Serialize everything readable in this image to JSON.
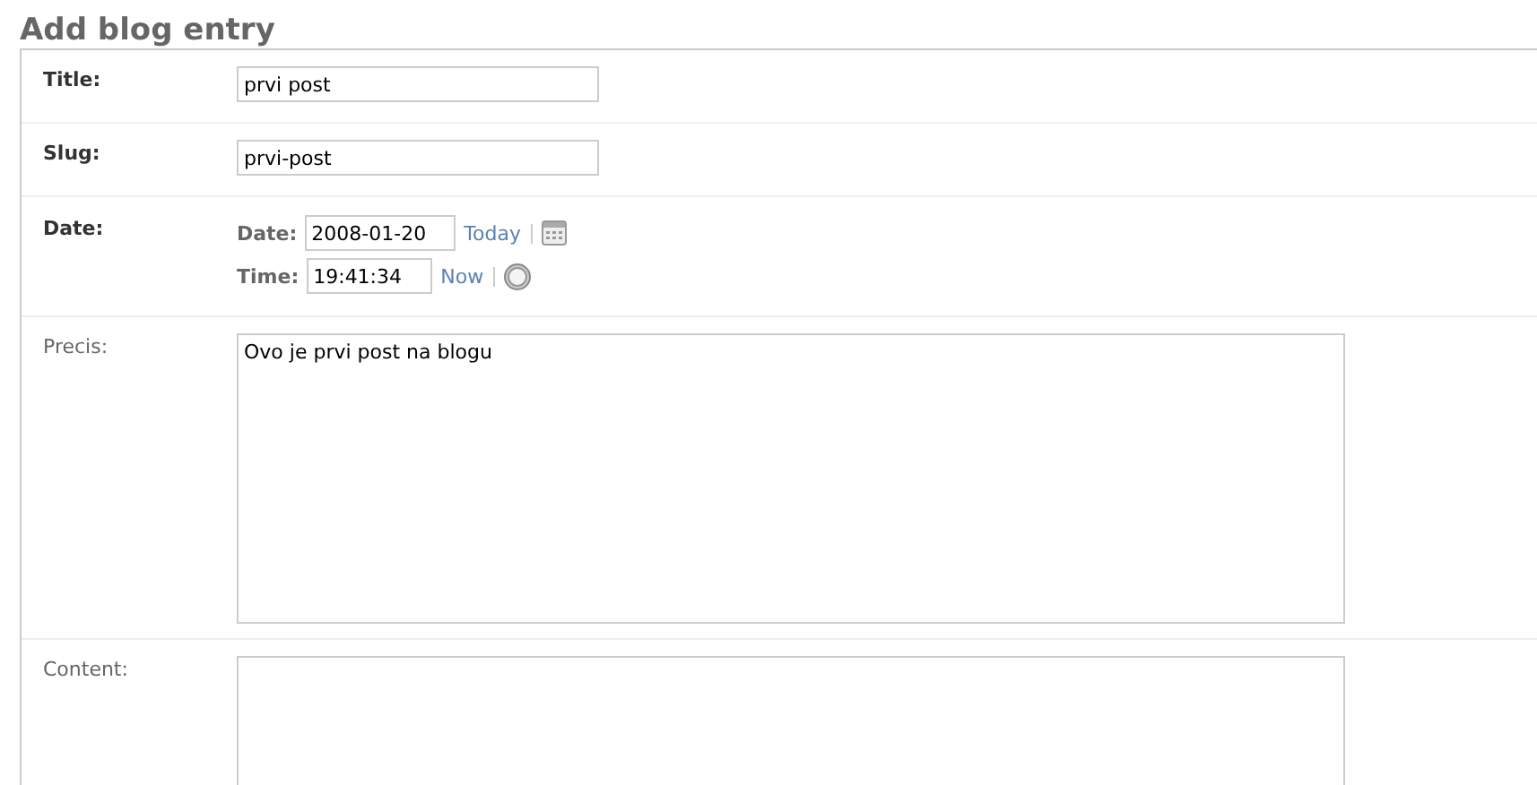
{
  "heading": "Add blog entry",
  "fields": [
    {
      "kind": "text",
      "label": "Title:",
      "required": true,
      "value": "prvi post"
    },
    {
      "kind": "text",
      "label": "Slug:",
      "required": true,
      "value": "prvi-post"
    },
    {
      "kind": "datetime",
      "label": "Date:",
      "required": true,
      "date_label": "Date:",
      "date_value": "2008-01-20",
      "today_link": "Today",
      "time_label": "Time:",
      "time_value": "19:41:34",
      "now_link": "Now"
    },
    {
      "kind": "textarea",
      "label": "Precis:",
      "required": false,
      "value": "Ovo je prvi post na blogu"
    },
    {
      "kind": "textarea",
      "label": "Content:",
      "required": false
    }
  ]
}
